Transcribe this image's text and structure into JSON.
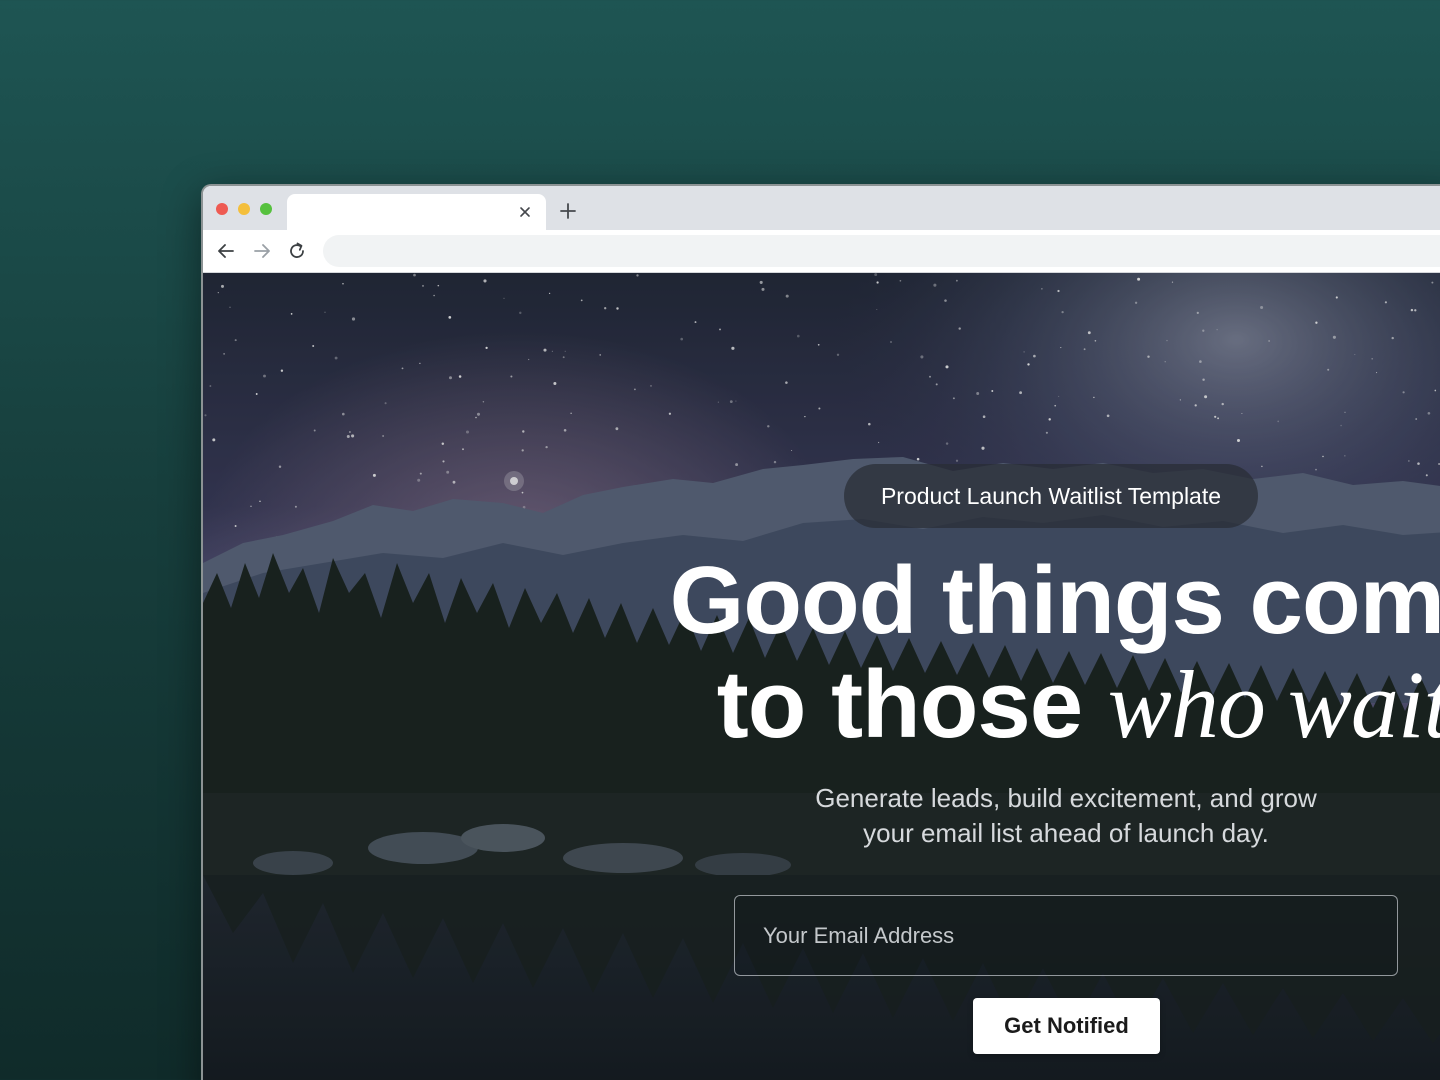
{
  "browser": {
    "tab": {
      "title": ""
    },
    "address": {
      "url": ""
    }
  },
  "hero": {
    "badge": "Product Launch Waitlist Template",
    "headline": {
      "line1": "Good things come",
      "line2_regular": "to those",
      "line2_italic": "who wait"
    },
    "subheadline_line1": "Generate leads, build excitement, and grow",
    "subheadline_line2": "your email list ahead of launch day.",
    "email_placeholder": "Your Email Address",
    "cta_label": "Get Notified"
  },
  "icons": {
    "window_controls": [
      "close-dot",
      "minimize-dot",
      "maximize-dot"
    ],
    "tab_close": "close-icon",
    "new_tab": "plus-icon",
    "navigation": [
      "back-arrow-icon",
      "forward-arrow-icon",
      "reload-icon"
    ]
  },
  "colors": {
    "page_background": "#1e5553",
    "traffic_red": "#ee5a52",
    "traffic_yellow": "#f4bf3c",
    "traffic_green": "#56c13e",
    "cta_background": "#ffffff"
  }
}
